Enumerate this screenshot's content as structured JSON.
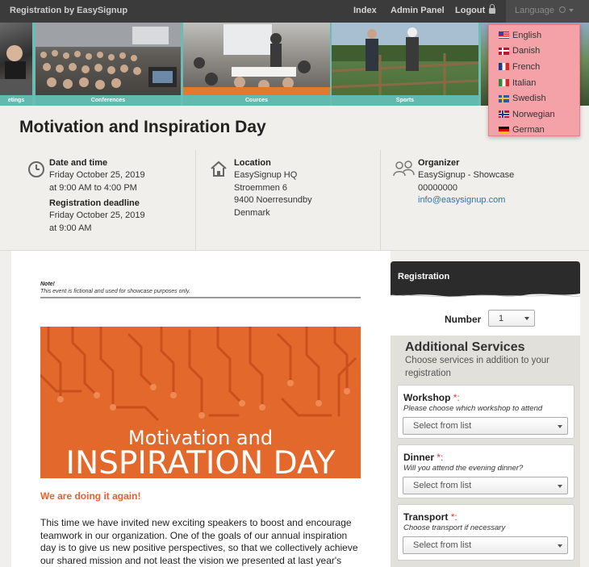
{
  "nav": {
    "brand": "Registration by EasySignup",
    "index": "Index",
    "admin": "Admin Panel",
    "logout": "Logout",
    "language": "Language"
  },
  "banner": {
    "captions": [
      "etings",
      "Conferences",
      "Cources",
      "Sports"
    ]
  },
  "languages": [
    {
      "label": "English",
      "flag": "us"
    },
    {
      "label": "Danish",
      "flag": "dk"
    },
    {
      "label": "French",
      "flag": "fr"
    },
    {
      "label": "Italian",
      "flag": "it"
    },
    {
      "label": "Swedish",
      "flag": "se"
    },
    {
      "label": "Norwegian",
      "flag": "no"
    },
    {
      "label": "German",
      "flag": "de"
    }
  ],
  "event": {
    "title": "Motivation and Inspiration Day",
    "date_heading": "Date and time",
    "date_line1": "Friday October 25, 2019",
    "date_line2": "at 9:00 AM to 4:00 PM",
    "deadline_heading": "Registration deadline",
    "deadline_line1": "Friday October 25, 2019",
    "deadline_line2": "at 9:00 AM",
    "location_heading": "Location",
    "location_lines": [
      "EasySignup HQ",
      "Stroemmen 6",
      "9400 Noerresundby",
      "Denmark"
    ],
    "organizer_heading": "Organizer",
    "organizer_lines": [
      "EasySignup - Showcase",
      "00000000"
    ],
    "organizer_email": "info@easysignup.com"
  },
  "content": {
    "note_heading": "Note!",
    "note_text": "This event is fictional and used for showcase purposes only.",
    "hero_line1": "Motivation and",
    "hero_line2": "INSPIRATION DAY",
    "tagline": "We are doing it again!",
    "paragraph": "This time we have invited new exciting speakers to boost and encourage teamwork in our organization. One of the goals of our annual inspiration day is to give us new positive perspectives, so that we collectively achieve our shared mission and not least the vision we presented at last year's inspiration day."
  },
  "registration": {
    "heading": "Registration",
    "number_label": "Number",
    "number_value": "1",
    "additional_title": "Additional Services",
    "additional_sub": "Choose services in addition to your registration",
    "services": [
      {
        "label": "Workshop",
        "required": "*:",
        "hint": "Please choose which workshop to attend",
        "select": "Select from list"
      },
      {
        "label": "Dinner",
        "required": "*:",
        "hint": "Will you attend the evening dinner?",
        "select": "Select from list"
      },
      {
        "label": "Transport",
        "required": "*:",
        "hint": "Choose transport if necessary",
        "select": "Select from list"
      }
    ]
  },
  "colors": {
    "accent_orange": "#e3682c",
    "teal": "#62b9ae",
    "link": "#2f72b8",
    "dropdown_bg": "#f4a2a8"
  }
}
